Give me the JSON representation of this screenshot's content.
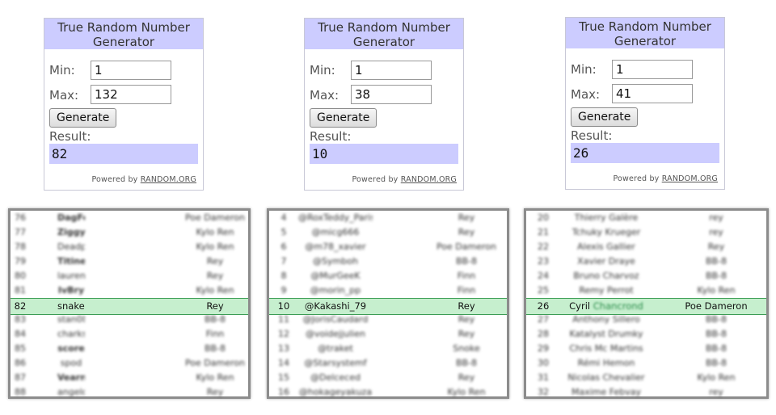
{
  "widgets": [
    {
      "title": "True Random Number Generator",
      "min_label": "Min:",
      "max_label": "Max:",
      "min": "1",
      "max": "132",
      "button": "Generate",
      "result_label": "Result:",
      "result": "82",
      "powered_by": "Powered by ",
      "powered_link": "RANDOM.ORG"
    },
    {
      "title": "True Random Number Generator",
      "min_label": "Min:",
      "max_label": "Max:",
      "min": "1",
      "max": "38",
      "button": "Generate",
      "result_label": "Result:",
      "result": "10",
      "powered_by": "Powered by ",
      "powered_link": "RANDOM.ORG"
    },
    {
      "title": "True Random Number Generator",
      "min_label": "Min:",
      "max_label": "Max:",
      "min": "1",
      "max": "41",
      "button": "Generate",
      "result_label": "Result:",
      "result": "26",
      "powered_by": "Powered by ",
      "powered_link": "RANDOM.ORG"
    }
  ],
  "tables": [
    {
      "rows": [
        [
          "76",
          "DagFortune",
          "Poe Dameron"
        ],
        [
          "77",
          "Ziggy",
          "Kylo Ren"
        ],
        [
          "78",
          "Deadpixel",
          "Kylo Ren"
        ],
        [
          "79",
          "Titinez",
          "Rey"
        ],
        [
          "80",
          "laurence",
          "Rey"
        ],
        [
          "81",
          "IvBry",
          "Kylo Ren"
        ],
        [
          "82",
          "snake545454",
          "Rey"
        ],
        [
          "83",
          "stan0805",
          "BB-8"
        ],
        [
          "84",
          "charks",
          "Finn"
        ],
        [
          "85",
          "score",
          "BB-8"
        ],
        [
          "86",
          "spod",
          "Poe Dameron"
        ],
        [
          "87",
          "Vearn",
          "Kylo Ren"
        ],
        [
          "88",
          "angelofsoul",
          "Rey"
        ]
      ]
    },
    {
      "rows": [
        [
          "4",
          "@RoxTeddy_Paris",
          "Rey"
        ],
        [
          "5",
          "@micg666",
          "Rey"
        ],
        [
          "6",
          "@m78_xavier",
          "Poe Dameron"
        ],
        [
          "7",
          "@Symboh",
          "BB-8"
        ],
        [
          "8",
          "@MurGeeK",
          "Finn"
        ],
        [
          "9",
          "@morin_pp",
          "Finn"
        ],
        [
          "10",
          "@Kakashi_79",
          "Rey"
        ],
        [
          "11",
          "@JorisCaudard",
          "Rey"
        ],
        [
          "12",
          "@voidejjulien",
          "Rey"
        ],
        [
          "13",
          "@traket",
          "Snoke"
        ],
        [
          "14",
          "@Starsystemf",
          "BB-8"
        ],
        [
          "15",
          "@Delceced",
          "Rey"
        ],
        [
          "16",
          "@hokageyakuza",
          "Kylo Ren"
        ]
      ]
    },
    {
      "rows": [
        [
          "20",
          "Thierry Galère",
          "rey"
        ],
        [
          "21",
          "Tchuky Krueger",
          "rey"
        ],
        [
          "22",
          "Alexis Gallier",
          "Rey"
        ],
        [
          "23",
          "Xavier Draye",
          "BB-8"
        ],
        [
          "24",
          "Bruno Charvoz",
          "BB-8"
        ],
        [
          "25",
          "Remy Perrot",
          "Kylo Ren"
        ],
        [
          "26",
          "Cyril",
          "Poe Dameron"
        ],
        [
          "27",
          "Anthony Sillero",
          "BB-8"
        ],
        [
          "28",
          "Katalyst Drumky",
          "BB-8"
        ],
        [
          "29",
          "Chris Mc Martins",
          "BB-8"
        ],
        [
          "30",
          "Rémi Hemon",
          "BB-8"
        ],
        [
          "31",
          "Nicolas Chevalier",
          "Kylo Ren"
        ],
        [
          "32",
          "Maxime Febvay",
          "rey"
        ]
      ],
      "highlight_blurred_surname": "Chancrond"
    }
  ]
}
